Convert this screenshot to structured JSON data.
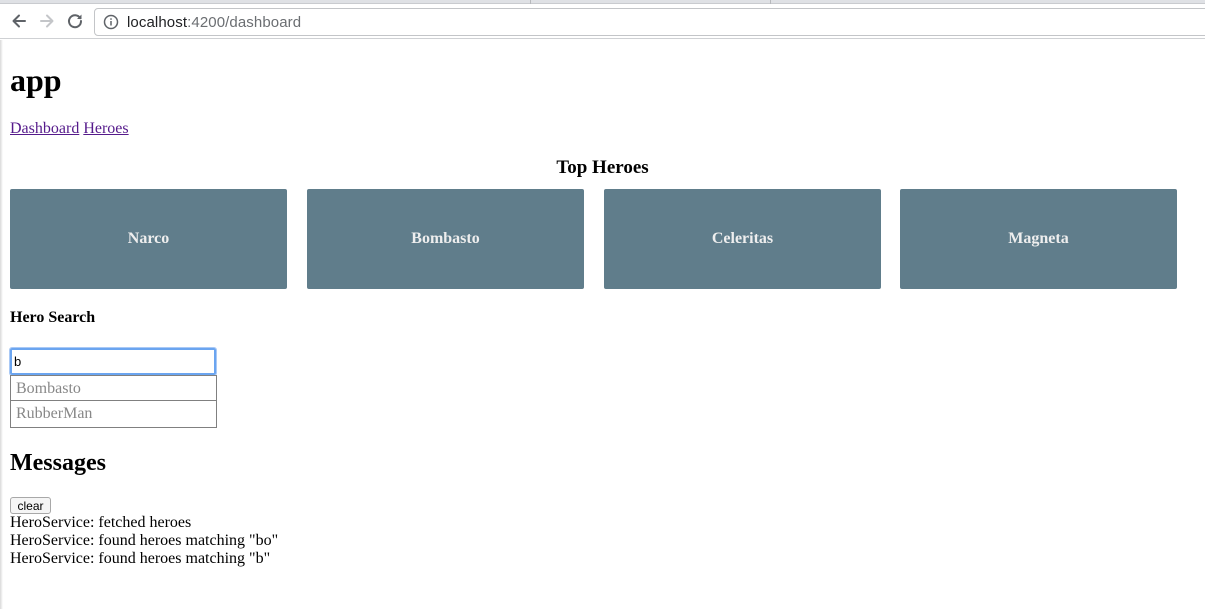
{
  "browser": {
    "url_host": "localhost",
    "url_rest": ":4200/dashboard"
  },
  "page": {
    "app_title": "app",
    "nav": {
      "dashboard": "Dashboard",
      "heroes": "Heroes"
    },
    "top_heroes_title": "Top Heroes",
    "top_heroes": [
      "Narco",
      "Bombasto",
      "Celeritas",
      "Magneta"
    ],
    "hero_search_title": "Hero Search",
    "search": {
      "value": "b"
    },
    "search_results": [
      "Bombasto",
      "RubberMan"
    ],
    "messages_title": "Messages",
    "clear_label": "clear",
    "messages": [
      "HeroService: fetched heroes",
      "HeroService: found heroes matching \"bo\"",
      "HeroService: found heroes matching \"b\""
    ]
  },
  "colors": {
    "hero_card": "#607d8b",
    "hero_text": "#eeeeee",
    "visited_link": "#551a8b",
    "search_focus": "#6ba5f0",
    "result_text": "#888888"
  },
  "icons": {
    "back": "arrow-left-icon",
    "forward": "arrow-right-icon",
    "reload": "reload-icon",
    "info": "info-icon"
  }
}
